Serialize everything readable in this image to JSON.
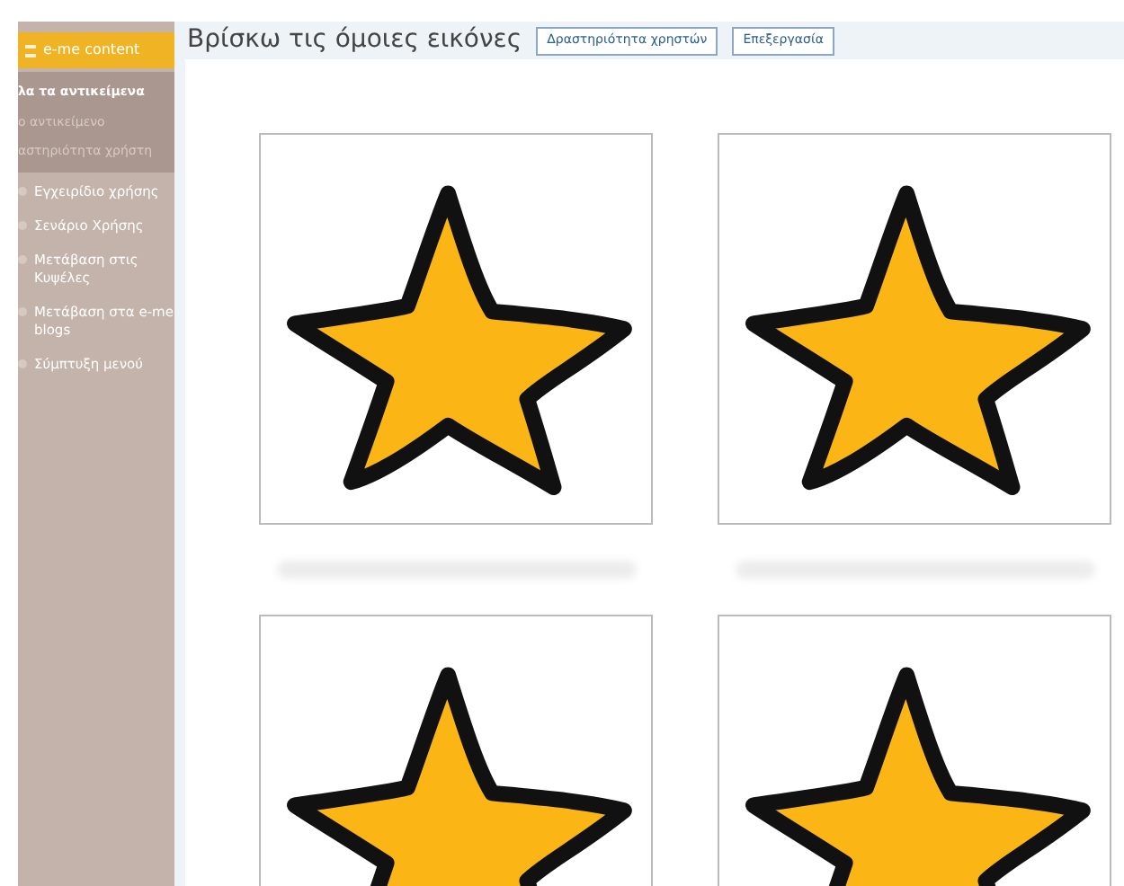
{
  "sidebar": {
    "header": "e-me content",
    "sub_items": [
      {
        "label": "λα τα αντικείμενα",
        "selected": true
      },
      {
        "label": "ο αντικείμενο",
        "selected": false
      },
      {
        "label": "αστηριότητα χρήστη",
        "selected": false
      }
    ],
    "menu": [
      {
        "label": "Εγχειρίδιο χρήσης"
      },
      {
        "label": "Σενάριο Χρήσης"
      },
      {
        "label": "Μετάβαση στις Κυψέλες"
      },
      {
        "label": "Μετάβαση στα e-me blogs"
      },
      {
        "label": "Σύμπτυξη μενού"
      }
    ]
  },
  "page": {
    "title": "Βρίσκω τις όμοιες εικόνες",
    "buttons": [
      "Δραστηριότητα χρηστών",
      "Επεξεργασία"
    ]
  },
  "cards": [
    {
      "kind": "star"
    },
    {
      "kind": "star"
    },
    {
      "kind": "star"
    },
    {
      "kind": "star"
    }
  ]
}
